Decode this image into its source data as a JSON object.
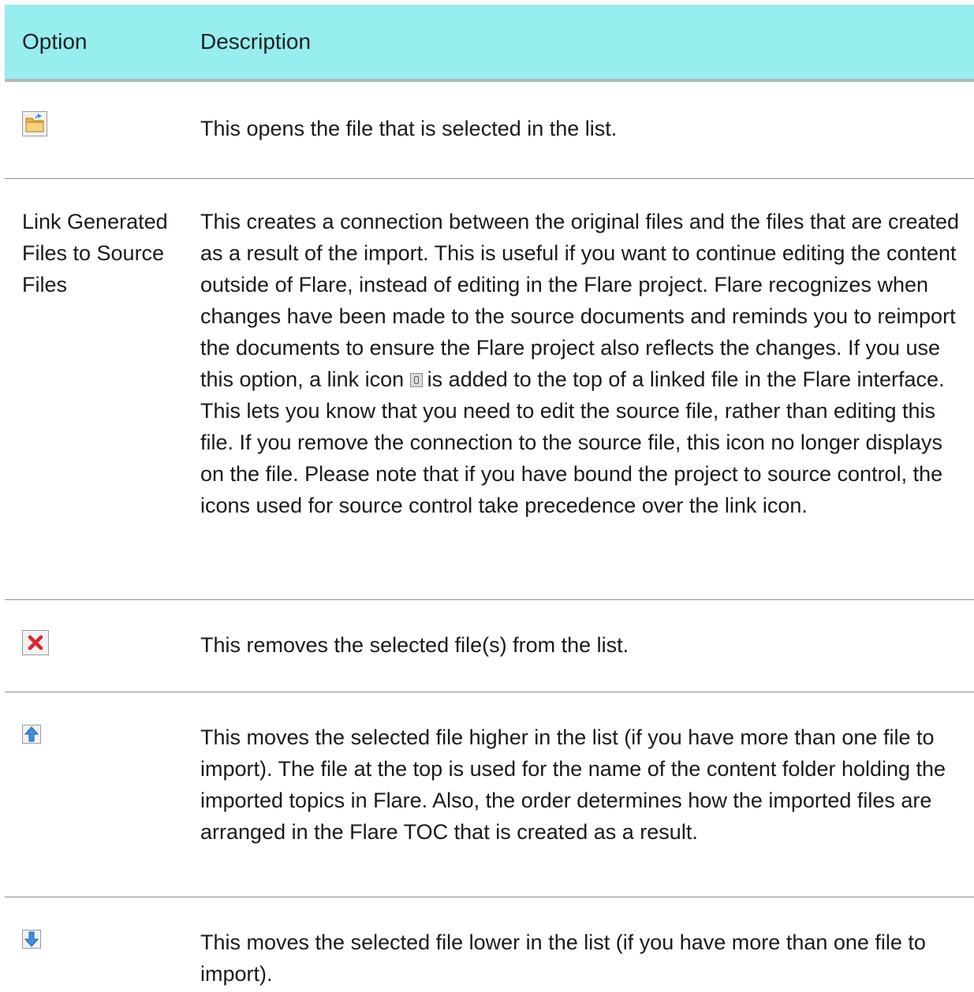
{
  "header": {
    "option": "Option",
    "description": "Description"
  },
  "rows": [
    {
      "option_label": "",
      "option_icon": "open-folder-icon",
      "description": "This opens the file that is selected in the list."
    },
    {
      "option_label": "Link Generated Files to Source Files",
      "option_icon": "",
      "description_before_icon": "This creates a connection between the original files and the files that are created as a result of the import. This is useful if you want to continue editing the content outside of Flare, instead of editing in the Flare project. Flare recognizes when changes have been made to the source documents and reminds you to reimport the documents to ensure the Flare project also reflects the changes. If you use this option, a link icon",
      "inline_icon": "link-icon",
      "description_after_icon": "is added to the top of a linked file in the Flare interface. This lets you know that you need to edit the source file, rather than editing this file. If you remove the connection to the source file, this icon no longer displays on the file. Please note that if you have bound the project to source control, the icons used for source control take precedence over the link icon."
    },
    {
      "option_label": "",
      "option_icon": "remove-x-icon",
      "description": "This removes the selected file(s) from the list."
    },
    {
      "option_label": "",
      "option_icon": "move-up-arrow-icon",
      "description": "This moves the selected file higher in the list (if you have more than one file to import). The file at the top is used for the name of the content folder holding the imported topics in Flare. Also, the order determines how the imported files are arranged in the Flare TOC that is created as a result."
    },
    {
      "option_label": "",
      "option_icon": "move-down-arrow-icon",
      "description": "This moves the selected file lower in the list (if you have more than one file to import)."
    }
  ],
  "colors": {
    "header_bg": "#96eeee",
    "divider": "#8e8e8e",
    "text": "#1a1a1a"
  }
}
